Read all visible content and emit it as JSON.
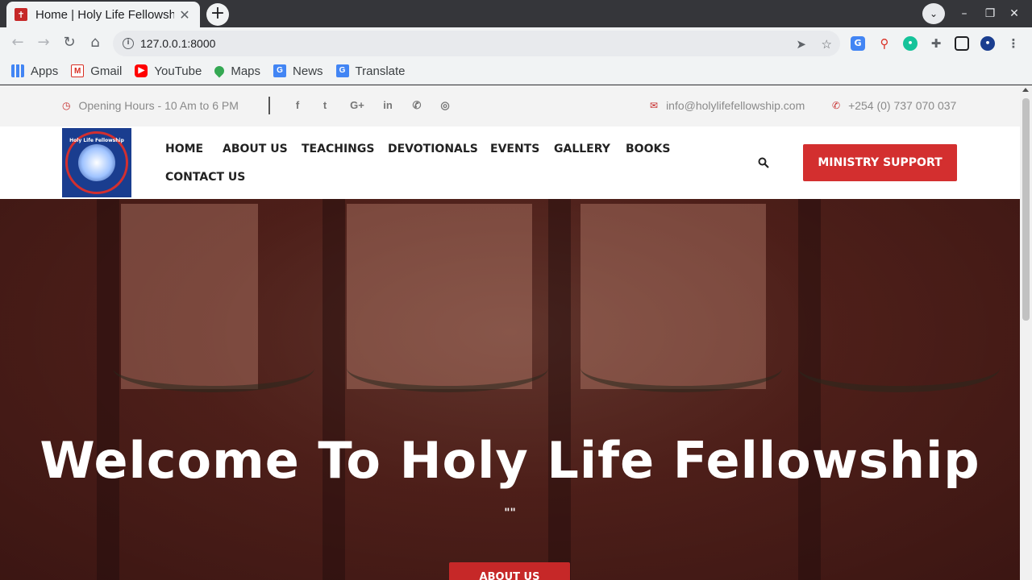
{
  "browser": {
    "tab_title": "Home | Holy Life Fellowship",
    "tab_favicon_glyph": "✝",
    "url": "127.0.0.1:8000",
    "bookmarks": [
      {
        "label": "Apps",
        "icon": "apps-grid-icon"
      },
      {
        "label": "Gmail",
        "icon": "gmail-icon"
      },
      {
        "label": "YouTube",
        "icon": "youtube-icon"
      },
      {
        "label": "Maps",
        "icon": "maps-icon"
      },
      {
        "label": "News",
        "icon": "news-icon"
      },
      {
        "label": "Translate",
        "icon": "translate-icon"
      }
    ]
  },
  "topbar": {
    "hours": "Opening Hours - 10 Am to 6 PM",
    "social": [
      {
        "glyph": "f",
        "icon": "facebook-icon"
      },
      {
        "glyph": "t",
        "icon": "twitter-icon"
      },
      {
        "glyph": "G+",
        "icon": "google-plus-icon"
      },
      {
        "glyph": "in",
        "icon": "linkedin-icon"
      },
      {
        "glyph": "✆",
        "icon": "whatsapp-icon"
      },
      {
        "glyph": "◎",
        "icon": "instagram-icon"
      }
    ],
    "email": "info@holylifefellowship.com",
    "phone": "+254 (0) 737 070 037"
  },
  "logo": {
    "text": "Holy Life Fellowship"
  },
  "nav": {
    "items": [
      "HOME",
      "ABOUT US",
      "TEACHINGS",
      "DEVOTIONALS",
      "EVENTS",
      "GALLERY",
      "BOOKS",
      "CONTACT US"
    ],
    "cta": "MINISTRY SUPPORT"
  },
  "hero": {
    "title": "Welcome To Holy Life Fellowship",
    "subtitle": "\"\"",
    "button": "ABOUT US"
  },
  "colors": {
    "accent": "#d32f2f",
    "topbar_bg": "#f3f3f3",
    "hero_overlay": "#3c1412"
  }
}
